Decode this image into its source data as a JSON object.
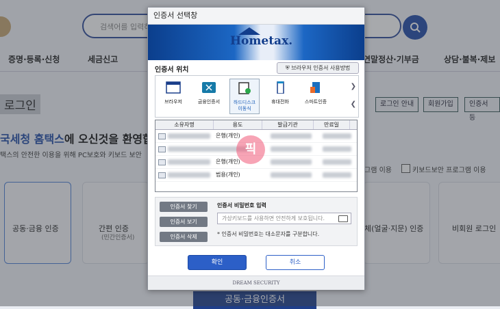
{
  "page": {
    "search_placeholder": "검색어를 입력하세",
    "nav": [
      "증명·등록·신청",
      "세금신고",
      "연말정산·기부금",
      "상담·불복·제보"
    ],
    "login_title": "로그인",
    "top_buttons": [
      "로그인 안내",
      "회원가입",
      "인증서 등"
    ],
    "welcome_brand": "국세청 홈택스",
    "welcome_rest": "에 오신것을 환영합",
    "welcome_sub": "택스의 안전한 이용을 위해 PC보호와 키보드 보안",
    "check1": "그램 이용",
    "check2": "키보드보안 프로그램 이용",
    "cards": [
      {
        "label": "공동·금융 인증",
        "sub": ""
      },
      {
        "label": "간편 인증",
        "sub": "(민간인증서)"
      },
      {
        "label": "체(얼굴·지문) 인증",
        "sub": ""
      },
      {
        "label": "비회원 로그인",
        "sub": ""
      }
    ],
    "bottom_button": "공동·금융인증서"
  },
  "dialog": {
    "title": "인증서 선택창",
    "banner_logo": "Hometax.",
    "location_title": "인증서 위치",
    "help_button": "브라우저 인증서 사용방법",
    "locations": [
      {
        "label": "브라우저",
        "icon": "browser-icon"
      },
      {
        "label": "금융인증서",
        "icon": "financial-cert-icon"
      },
      {
        "label": "하드디스크\n이동식",
        "icon": "harddisk-icon",
        "selected": true
      },
      {
        "label": "휴대전화",
        "icon": "phone-icon"
      },
      {
        "label": "스마트인증",
        "icon": "smart-cert-icon"
      }
    ],
    "columns": [
      "소유자명",
      "용도",
      "발급기관",
      "만료일"
    ],
    "rows": [
      {
        "usage": "은행(개인)"
      },
      {
        "usage": ""
      },
      {
        "usage": "은행(개인)"
      },
      {
        "usage": "범용(개인)"
      }
    ],
    "watermark": "픽",
    "side_buttons": [
      "인증서 찾기",
      "인증서 보기",
      "인증서 삭제"
    ],
    "password_label": "인증서 비밀번호 입력",
    "password_placeholder": "가상키보드를 사용하면 안전하게 보호됩니다.",
    "password_note": "* 인증서 비밀번호는 대소문자를 구분합니다.",
    "ok_label": "확인",
    "cancel_label": "취소",
    "footer": "DREAM SECURITY"
  },
  "colors": {
    "accent": "#2c5fc7",
    "brand": "#1e4aa6"
  }
}
